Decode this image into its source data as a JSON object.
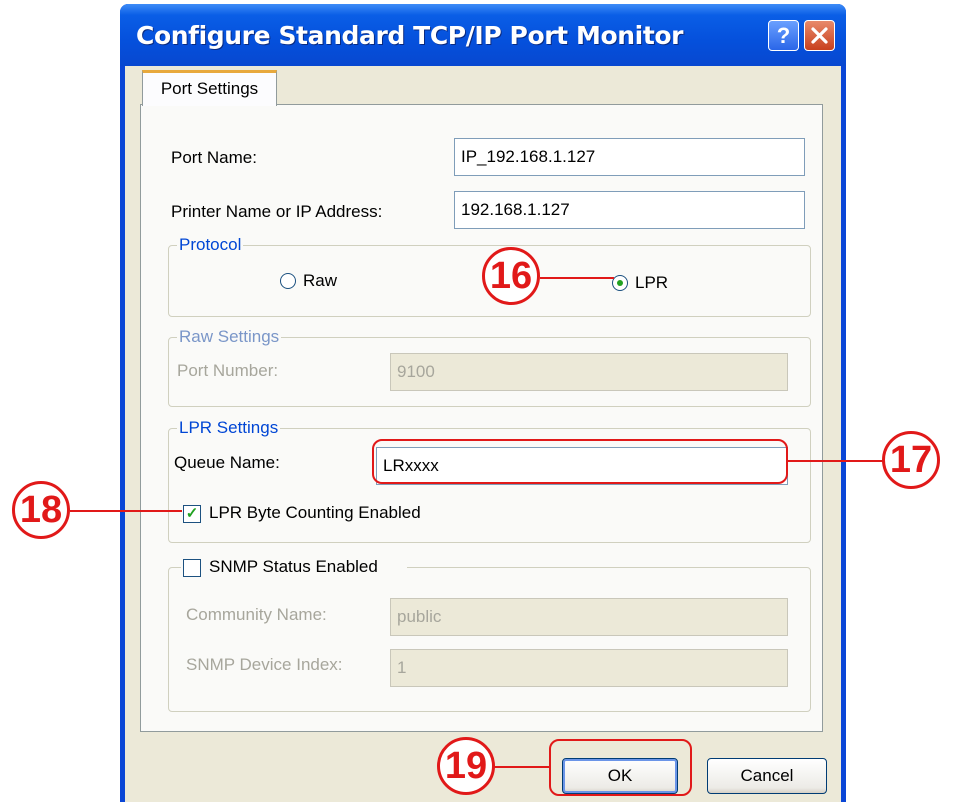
{
  "window": {
    "title": "Configure Standard TCP/IP Port Monitor",
    "help_glyph": "?"
  },
  "tabs": [
    {
      "label": "Port Settings",
      "active": true
    }
  ],
  "fields": {
    "port_name": {
      "label": "Port Name:",
      "value": "IP_192.168.1.127"
    },
    "printer_address": {
      "label": "Printer Name or IP Address:",
      "value": "192.168.1.127"
    }
  },
  "protocol": {
    "title": "Protocol",
    "options": [
      {
        "label": "Raw",
        "selected": false
      },
      {
        "label": "LPR",
        "selected": true
      }
    ]
  },
  "raw_settings": {
    "title": "Raw Settings",
    "port_number_label": "Port Number:",
    "port_number_value": "9100",
    "enabled": false
  },
  "lpr_settings": {
    "title": "LPR Settings",
    "queue_name_label": "Queue Name:",
    "queue_name_value": "LRxxxx",
    "byte_counting_label": "LPR Byte Counting Enabled",
    "byte_counting_checked": true
  },
  "snmp": {
    "status_label": "SNMP Status Enabled",
    "status_checked": false,
    "community_label": "Community Name:",
    "community_value": "public",
    "device_index_label": "SNMP Device Index:",
    "device_index_value": "1",
    "enabled": false
  },
  "buttons": {
    "ok": "OK",
    "cancel": "Cancel"
  },
  "callouts": {
    "protocol": "16",
    "queue": "17",
    "byte_counting": "18",
    "ok": "19"
  },
  "colors": {
    "titlebar": "#0550dc",
    "annotation": "#e11919",
    "group_title": "#0046d5"
  }
}
